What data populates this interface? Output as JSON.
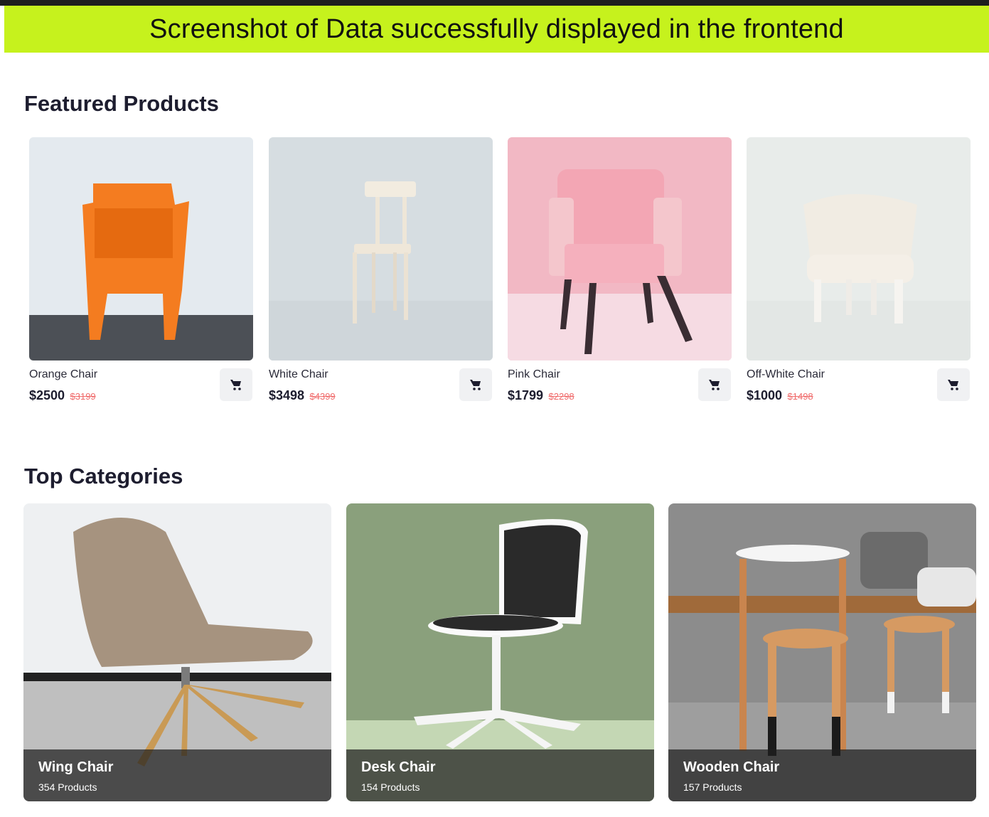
{
  "banner": {
    "text": "Screenshot of Data successfully displayed in the frontend"
  },
  "featured": {
    "title": "Featured Products",
    "products": [
      {
        "name": "Orange Chair",
        "price": "$2500",
        "old_price": "$3199",
        "image_icon": "orange-chair-image"
      },
      {
        "name": "White Chair",
        "price": "$3498",
        "old_price": "$4399",
        "image_icon": "white-chair-image"
      },
      {
        "name": "Pink Chair",
        "price": "$1799",
        "old_price": "$2298",
        "image_icon": "pink-chair-image"
      },
      {
        "name": "Off-White Chair",
        "price": "$1000",
        "old_price": "$1498",
        "image_icon": "off-white-chair-image"
      }
    ]
  },
  "categories": {
    "title": "Top Categories",
    "items": [
      {
        "name": "Wing Chair",
        "count": "354 Products",
        "image_icon": "wing-chair-image"
      },
      {
        "name": "Desk Chair",
        "count": "154 Products",
        "image_icon": "desk-chair-image"
      },
      {
        "name": "Wooden Chair",
        "count": "157 Products",
        "image_icon": "wooden-chair-image"
      }
    ]
  },
  "icons": {
    "cart": "cart-icon"
  },
  "colors": {
    "banner": "#c6f21d",
    "old_price": "#f06b6b",
    "heading": "#1d1d2f"
  }
}
